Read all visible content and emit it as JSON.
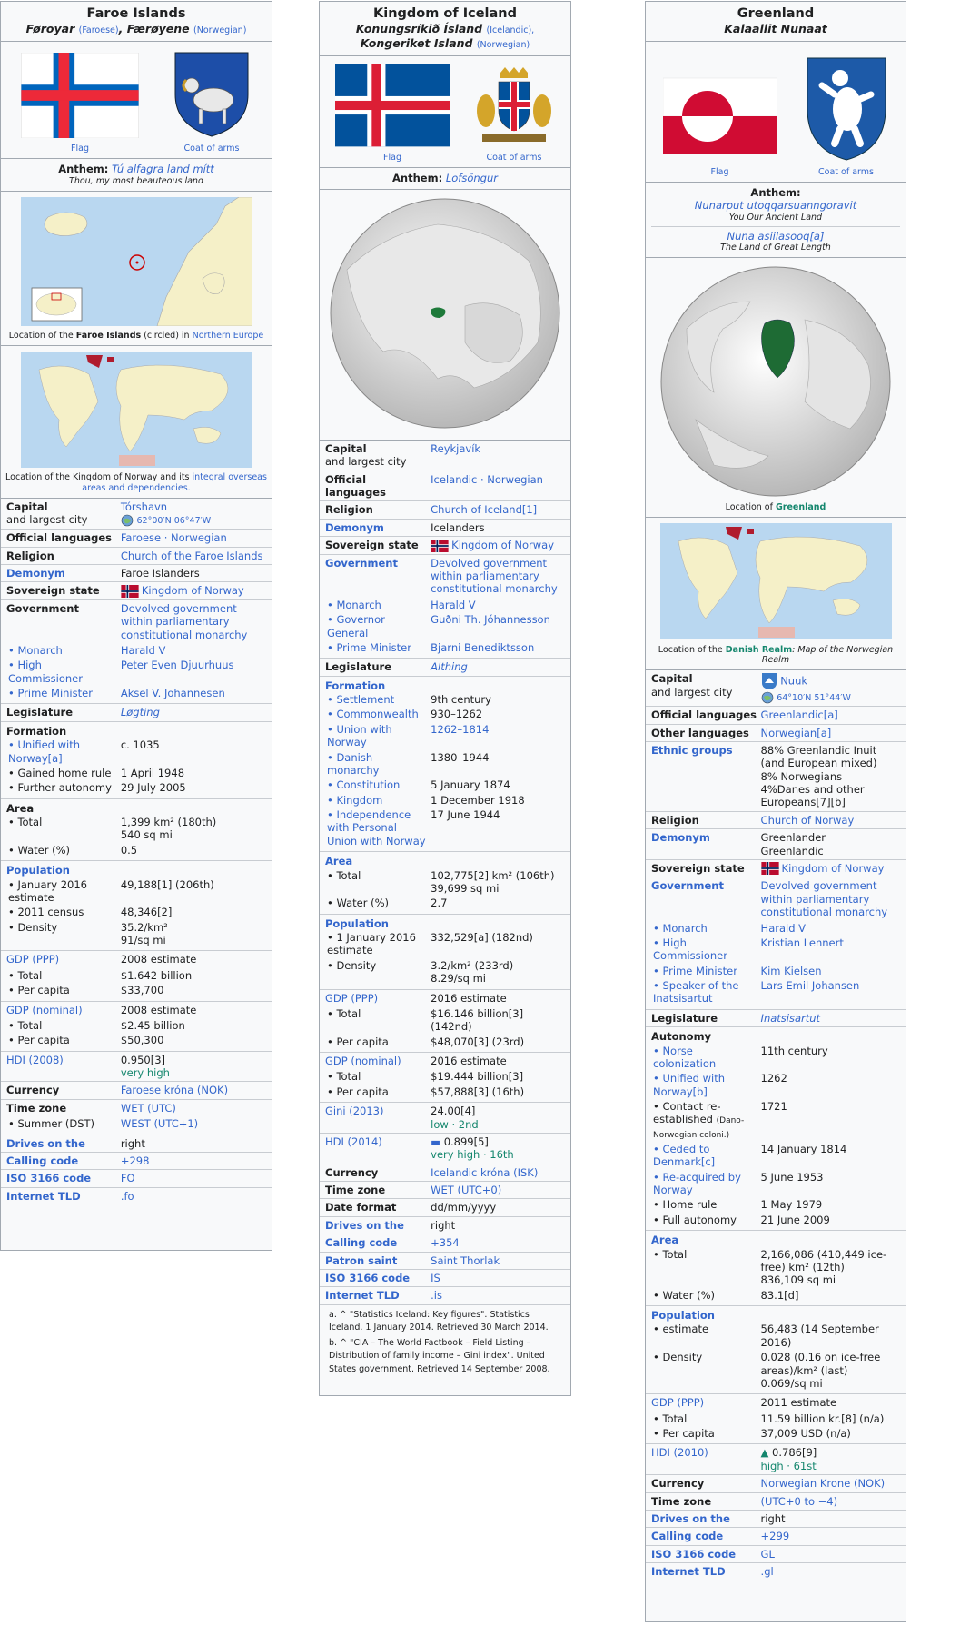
{
  "faroe": {
    "title": "Faroe Islands",
    "native_1": "Føroyar",
    "native_1_lang": "(Faroese)",
    "native_2": "Færøyene",
    "native_2_lang": "(Norwegian)",
    "flag_caption": "Flag",
    "coa_caption": "Coat of arms",
    "anthem_label": "Anthem:",
    "anthem": "Tú alfagra land mítt",
    "anthem_translation": "Thou, my most beauteous land",
    "map1_caption_a": "Location of the",
    "map1_caption_b": "Faroe Islands",
    "map1_caption_c": "(circled) in",
    "map1_caption_d": "Northern Europe",
    "map2_caption_a": "Location of the Kingdom of Norway and its",
    "map2_caption_b": "integral overseas areas and dependencies.",
    "rows": {
      "capital_l1": "Capital",
      "capital_l2": "and largest city",
      "capital": "Tórshavn",
      "capital_coords": "62°00′N 06°47′W",
      "languages_l": "Official languages",
      "languages": "Faroese · Norwegian",
      "religion_l": "Religion",
      "religion": "Church of the Faroe Islands",
      "demonym_l": "Demonym",
      "demonym": "Faroe Islanders",
      "sovereign_l": "Sovereign state",
      "sovereign": "Kingdom of Norway",
      "gov_l": "Government",
      "gov": "Devolved government within parliamentary constitutional monarchy",
      "monarch_l": "• Monarch",
      "monarch": "Harald V",
      "hc_l": "• High Commissioner",
      "hc": "Peter Even Djuurhuus",
      "pm_l": "• Prime Minister",
      "pm": "Aksel V. Johannesen",
      "leg_l": "Legislature",
      "leg": "Løgting",
      "formation_l": "Formation",
      "f1_l": "• Unified with Norway[a]",
      "f1": "c. 1035",
      "f2_l": "• Gained home rule",
      "f2": "1 April 1948",
      "f3_l": "• Further autonomy",
      "f3": "29 July 2005",
      "area_l": "Area",
      "a1_l": "• Total",
      "a1": "1,399 km² (180th)",
      "a1b": "540 sq mi",
      "a2_l": "• Water (%)",
      "a2": "0.5",
      "pop_l": "Population",
      "p1_l": "• January 2016 estimate",
      "p1": "49,188[1] (206th)",
      "p2_l": "• 2011 census",
      "p2": "48,346[2]",
      "p3_l": "• Density",
      "p3": "35.2/km²",
      "p3b": "91/sq mi",
      "gdpp_l": "GDP (PPP)",
      "gdpp": "2008 estimate",
      "gdpp1_l": "• Total",
      "gdpp1": "$1.642 billion",
      "gdpp2_l": "• Per capita",
      "gdpp2": "$33,700",
      "gdpn_l": "GDP (nominal)",
      "gdpn": "2008 estimate",
      "gdpn1_l": "• Total",
      "gdpn1": "$2.45 billion",
      "gdpn2_l": "• Per capita",
      "gdpn2": "$50,300",
      "hdi_l": "HDI (2008)",
      "hdi": "0.950[3]",
      "hdi_b": "very high",
      "currency_l": "Currency",
      "currency": "Faroese króna (NOK)",
      "tz_l": "Time zone",
      "tz": "WET (UTC)",
      "summer_l": "• Summer (DST)",
      "summer": "WEST (UTC+1)",
      "drives_l": "Drives on the",
      "drives": "right",
      "calling_l": "Calling code",
      "calling": "+298",
      "iso_l": "ISO 3166 code",
      "iso": "FO",
      "tld_l": "Internet TLD",
      "tld": ".fo"
    }
  },
  "iceland": {
    "title": "Kingdom of Iceland",
    "native_1": "Konungsríkið Ísland",
    "native_1_lang": "(Icelandic),",
    "native_2": "Kongeriket Island",
    "native_2_lang": "(Norwegian)",
    "flag_caption": "Flag",
    "coa_caption": "Coat of arms",
    "anthem_label": "Anthem:",
    "anthem": "Lofsöngur",
    "rows": {
      "capital_l1": "Capital",
      "capital_l2": "and largest city",
      "capital": "Reykjavík",
      "languages_l": "Official languages",
      "languages": "Icelandic · Norwegian",
      "religion_l": "Religion",
      "religion": "Church of Iceland[1]",
      "demonym_l": "Demonym",
      "demonym": "Icelanders",
      "sovereign_l": "Sovereign state",
      "sovereign": "Kingdom of Norway",
      "gov_l": "Government",
      "gov": "Devolved government within parliamentary constitutional monarchy",
      "monarch_l": "• Monarch",
      "monarch": "Harald V",
      "gg_l": "• Governor General",
      "gg": "Guðni Th. Jóhannesson",
      "pm_l": "• Prime Minister",
      "pm": "Bjarni Benediktsson",
      "leg_l": "Legislature",
      "leg": "Althing",
      "formation_l": "Formation",
      "f1_l": "• Settlement",
      "f1": "9th century",
      "f2_l": "• Commonwealth",
      "f2": "930–1262",
      "f3_l": "• Union with Norway",
      "f3": "1262–1814",
      "f4_l": "• Danish monarchy",
      "f4": "1380–1944",
      "f5_l": "• Constitution",
      "f5": "5 January 1874",
      "f6_l": "• Kingdom",
      "f6": "1 December 1918",
      "f7_l": "• Independence with Personal Union with Norway",
      "f7": "17 June 1944",
      "area_l": "Area",
      "a1_l": "• Total",
      "a1": "102,775[2] km² (106th)",
      "a1b": "39,699 sq mi",
      "a2_l": "• Water (%)",
      "a2": "2.7",
      "pop_l": "Population",
      "p1_l": "• 1 January 2016 estimate",
      "p1": "332,529[a] (182nd)",
      "p2_l": "• Density",
      "p2": "3.2/km² (233rd)",
      "p2b": "8.29/sq mi",
      "gdpp_l": "GDP (PPP)",
      "gdpp": "2016 estimate",
      "gdpp1_l": "• Total",
      "gdpp1": "$16.146 billion[3] (142nd)",
      "gdpp2_l": "• Per capita",
      "gdpp2": "$48,070[3] (23rd)",
      "gdpn_l": "GDP (nominal)",
      "gdpn": "2016 estimate",
      "gdpn1_l": "• Total",
      "gdpn1": "$19.444 billion[3]",
      "gdpn2_l": "• Per capita",
      "gdpn2": "$57,888[3] (16th)",
      "gini_l": "Gini (2013)",
      "gini": "24.00[4]",
      "gini_b": "low · 2nd",
      "hdi_l": "HDI (2014)",
      "hdi": "0.899[5]",
      "hdi_b": "very high · 16th",
      "currency_l": "Currency",
      "currency": "Icelandic króna (ISK)",
      "tz_l": "Time zone",
      "tz": "WET (UTC+0)",
      "date_l": "Date format",
      "date": "dd/mm/yyyy",
      "drives_l": "Drives on the",
      "drives": "right",
      "calling_l": "Calling code",
      "calling": "+354",
      "patron_l": "Patron saint",
      "patron": "Saint Thorlak",
      "iso_l": "ISO 3166 code",
      "iso": "IS",
      "tld_l": "Internet TLD",
      "tld": ".is"
    },
    "ref_a": "a. ^ \"Statistics Iceland: Key figures\". Statistics Iceland. 1 January 2014. Retrieved 30 March 2014.",
    "ref_b": "b. ^ \"CIA – The World Factbook – Field Listing – Distribution of family income – Gini index\". United States government. Retrieved 14 September 2008."
  },
  "greenland": {
    "title": "Greenland",
    "native_1": "Kalaallit Nunaat",
    "flag_caption": "Flag",
    "coa_caption": "Coat of arms",
    "anthem_label": "Anthem:",
    "anthem": "Nunarput utoqqarsuanngoravit",
    "anthem_translation": "You Our Ancient Land",
    "anthem2": "Nuna asiilasooq[a]",
    "anthem2_translation": "The Land of Great Length",
    "map1_caption_a": "Location of",
    "map1_caption_b": "Greenland",
    "map2_caption_a": "Location of the",
    "map2_caption_b": "Danish Realm",
    "map2_caption_c": ": Map of the Norwegian Realm",
    "rows": {
      "capital_l1": "Capital",
      "capital_l2": "and largest city",
      "capital": "Nuuk",
      "capital_coords": "64°10′N 51°44′W",
      "languages_l": "Official languages",
      "languages": "Greenlandic[a]",
      "other_l": "Other languages",
      "other": "Norwegian[a]",
      "ethnic_l": "Ethnic groups",
      "eth1": "88% Greenlandic Inuit (and European mixed)",
      "eth2": "8% Norwegians",
      "eth3": "4%Danes and other Europeans[7][b]",
      "religion_l": "Religion",
      "religion": "Church of Norway",
      "demonym_l": "Demonym",
      "demonym": "Greenlander",
      "demonym_b": "Greenlandic",
      "sovereign_l": "Sovereign state",
      "sovereign": "Kingdom of Norway",
      "gov_l": "Government",
      "gov": "Devolved government within parliamentary constitutional monarchy",
      "monarch_l": "• Monarch",
      "monarch": "Harald V",
      "hc_l": "• High Commissioner",
      "hc": "Kristian Lennert",
      "pm_l": "• Prime Minister",
      "pm": "Kim Kielsen",
      "sp_l": "• Speaker of the Inatsisartut",
      "sp": "Lars Emil Johansen",
      "leg_l": "Legislature",
      "leg": "Inatsisartut",
      "aut_l": "Autonomy",
      "au1_l": "• Norse colonization",
      "au1": "11th century",
      "au2_l": "• Unified with Norway[b]",
      "au2": "1262",
      "au3_l": "• Contact re-established",
      "au3_note": "(Dano-Norwegian coloni.)",
      "au3": "1721",
      "au4_l": "• Ceded to Denmark[c]",
      "au4": "14 January 1814",
      "au5_l": "• Re-acquired by Norway",
      "au5": "5 June 1953",
      "au6_l": "• Home rule",
      "au6": "1 May 1979",
      "au7_l": "• Full autonomy",
      "au7": "21 June 2009",
      "area_l": "Area",
      "a1_l": "• Total",
      "a1": "2,166,086 (410,449 ice-free) km² (12th)",
      "a1b": "836,109 sq mi",
      "a2_l": "• Water (%)",
      "a2": "83.1[d]",
      "pop_l": "Population",
      "p1_l": "• estimate",
      "p1": "56,483 (14 September 2016)",
      "p2_l": "• Density",
      "p2": "0.028 (0.16 on ice-free areas)/km² (last)",
      "p2b": "0.069/sq mi",
      "gdpp_l": "GDP (PPP)",
      "gdpp": "2011 estimate",
      "gdpp1_l": "• Total",
      "gdpp1": "11.59 billion kr.[8] (n/a)",
      "gdpp2_l": "• Per capita",
      "gdpp2": "37,009 USD (n/a)",
      "hdi_l": "HDI (2010)",
      "hdi": "0.786[9]",
      "hdi_b": "high · 61st",
      "currency_l": "Currency",
      "currency": "Norwegian Krone (NOK)",
      "tz_l": "Time zone",
      "tz": "(UTC+0 to −4)",
      "drives_l": "Drives on the",
      "drives": "right",
      "calling_l": "Calling code",
      "calling": "+299",
      "iso_l": "ISO 3166 code",
      "iso": "GL",
      "tld_l": "Internet TLD",
      "tld": ".gl"
    }
  }
}
